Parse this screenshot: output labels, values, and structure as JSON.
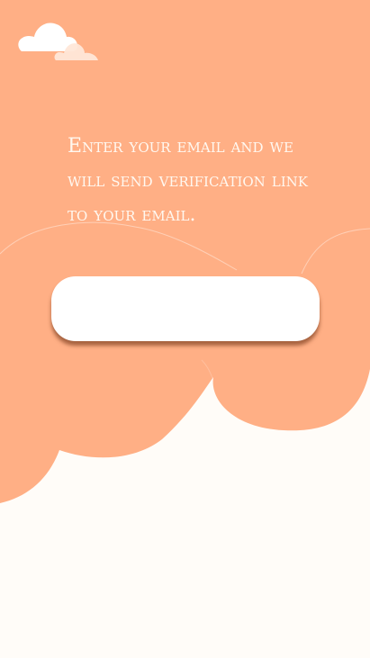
{
  "screen": {
    "prompt_text": "Enter your email and we will send verification link to your email.",
    "email_input": {
      "value": "",
      "placeholder": ""
    }
  },
  "theme": {
    "background": "#fffcf8",
    "orange": "#ffaf85",
    "cloud": "#ffffff",
    "text": "#fff8f0"
  },
  "icons": {
    "decorative": "cloud-icon"
  }
}
